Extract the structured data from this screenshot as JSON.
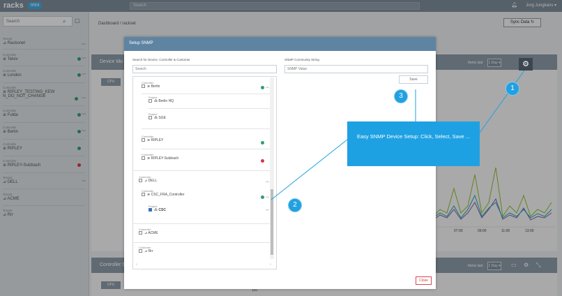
{
  "app": {
    "logo": "racks",
    "logo_badge": "mini",
    "search_placeholder": "Search",
    "user": "Jorg Jungkans ▾"
  },
  "sidebar": {
    "search_placeholder": "Search",
    "items": [
      {
        "kind": "Tenant",
        "label": "Rackonet"
      },
      {
        "kind": "Controller",
        "label": "Telviv",
        "status_color": "#2e9e6e"
      },
      {
        "kind": "Controller",
        "label": "London",
        "status_color": "#2e9e6e"
      },
      {
        "kind": "Controller",
        "label": "RIPLEY_TESTING_KEW N_DO_NOT_CHANGE"
      },
      {
        "kind": "Controller",
        "label": "Fulda",
        "status_color": "#2e9e6e"
      },
      {
        "kind": "Controller",
        "label": "Berlin",
        "status_color": "#2e9e6e"
      },
      {
        "kind": "Controller",
        "label": "RIPLEY",
        "status_color": "#2e9e6e"
      },
      {
        "kind": "Controller",
        "label": "RIPLEY-Sulzbach",
        "status_color": "#d8344a"
      },
      {
        "kind": "Tenant",
        "label": "DELL"
      },
      {
        "kind": "Tenant",
        "label": "ACME"
      },
      {
        "kind": "Tenant",
        "label": "Rrr"
      }
    ]
  },
  "main": {
    "breadcrumb": "Dashboard / rackset",
    "sync_label": "Sync Data ↻",
    "panel1_title": "Device Mo",
    "panel2_title": "Controller S",
    "items_last": "Items last",
    "days_1": "1 Day ▾",
    "cpu_label": "CPU",
    "times": [
      "07:00",
      "09:00",
      "11:00",
      "13:00"
    ],
    "y_tick": "110"
  },
  "modal": {
    "title": "Setup SNMP",
    "search_label": "Search for Device, Controller & Customer",
    "search_placeholder": "Search",
    "community_label": "SNMP Community String",
    "community_placeholder": "SNMP Value",
    "save_label": "Save",
    "close_label": "Close",
    "tree": {
      "berlin": {
        "kind": "Controller",
        "label": "Berlin"
      },
      "berlin_hq": {
        "kind": "Project",
        "label": "Berlin HQ"
      },
      "sge": {
        "kind": "Project",
        "label": "SGE"
      },
      "ripley": {
        "kind": "Controller",
        "label": "RIPLEY"
      },
      "ripley_s": {
        "kind": "Controller",
        "label": "RIPLEY-Sulzbach"
      },
      "dell": {
        "kind": "Customer",
        "label": "DELL"
      },
      "csc_fra": {
        "kind": "Controller",
        "label": "CSC_FRA_Controller"
      },
      "csc": {
        "kind": "Project",
        "label": "CSC"
      },
      "acme": {
        "kind": "Customer",
        "label": "ACME"
      },
      "rrr": {
        "kind": "Customer",
        "label": "Rrr"
      }
    }
  },
  "callouts": {
    "one": "1",
    "two": "2",
    "three": "3",
    "text": "Easy SNMP Device Setup: Click, Select, Save ..."
  },
  "colors": {
    "accent": "#1ea1e3",
    "modal_header": "#5f84a2",
    "ok": "#2e9e6e",
    "error": "#d8344a"
  }
}
